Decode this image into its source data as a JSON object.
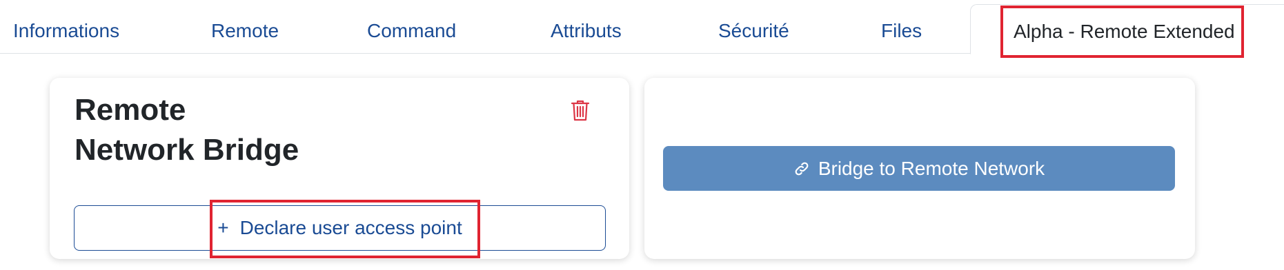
{
  "tabs": [
    {
      "label": "Informations"
    },
    {
      "label": "Remote"
    },
    {
      "label": "Command"
    },
    {
      "label": "Attributs"
    },
    {
      "label": "Sécurité"
    },
    {
      "label": "Files"
    },
    {
      "label": "Alpha - Remote Extended",
      "active": true
    }
  ],
  "card_left": {
    "title_line1": "Remote",
    "title_line2": "Network Bridge",
    "delete_icon": "trash-icon",
    "declare_button": {
      "icon": "plus",
      "plus_symbol": "+",
      "label": "Declare user access point"
    }
  },
  "card_right": {
    "bridge_button": {
      "icon": "link-icon",
      "label": "Bridge to Remote Network"
    }
  },
  "colors": {
    "tab_text": "#1a4b94",
    "highlight": "#e02431",
    "delete_icon": "#dc3545",
    "bridge_button_bg": "#5c8bbf",
    "declare_button_border": "#1a4b94"
  }
}
